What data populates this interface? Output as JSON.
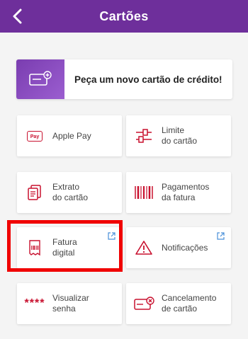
{
  "header": {
    "title": "Cartões"
  },
  "banner": {
    "label": "Peça um novo cartão de crédito!"
  },
  "cards": [
    {
      "label": "Apple Pay",
      "icon": "apple-pay-icon",
      "badge": "Pay"
    },
    {
      "label": "Limite\ndo cartão",
      "icon": "sliders-icon"
    },
    {
      "label": "Extrato\ndo cartão",
      "icon": "statement-icon"
    },
    {
      "label": "Pagamentos\nda fatura",
      "icon": "barcode-icon"
    },
    {
      "label": "Fatura\ndigital",
      "icon": "digital-invoice-icon"
    },
    {
      "label": "Notificações",
      "icon": "warning-icon"
    },
    {
      "label": "Visualizar\nsenha",
      "icon": "password-icon",
      "stars": "****"
    },
    {
      "label": "Cancelamento\nde cartão",
      "icon": "cancel-card-icon"
    }
  ],
  "colors": {
    "brand": "#6e2f9b",
    "accent": "#c8102e",
    "highlight": "#f00000",
    "link": "#4a90d9"
  }
}
